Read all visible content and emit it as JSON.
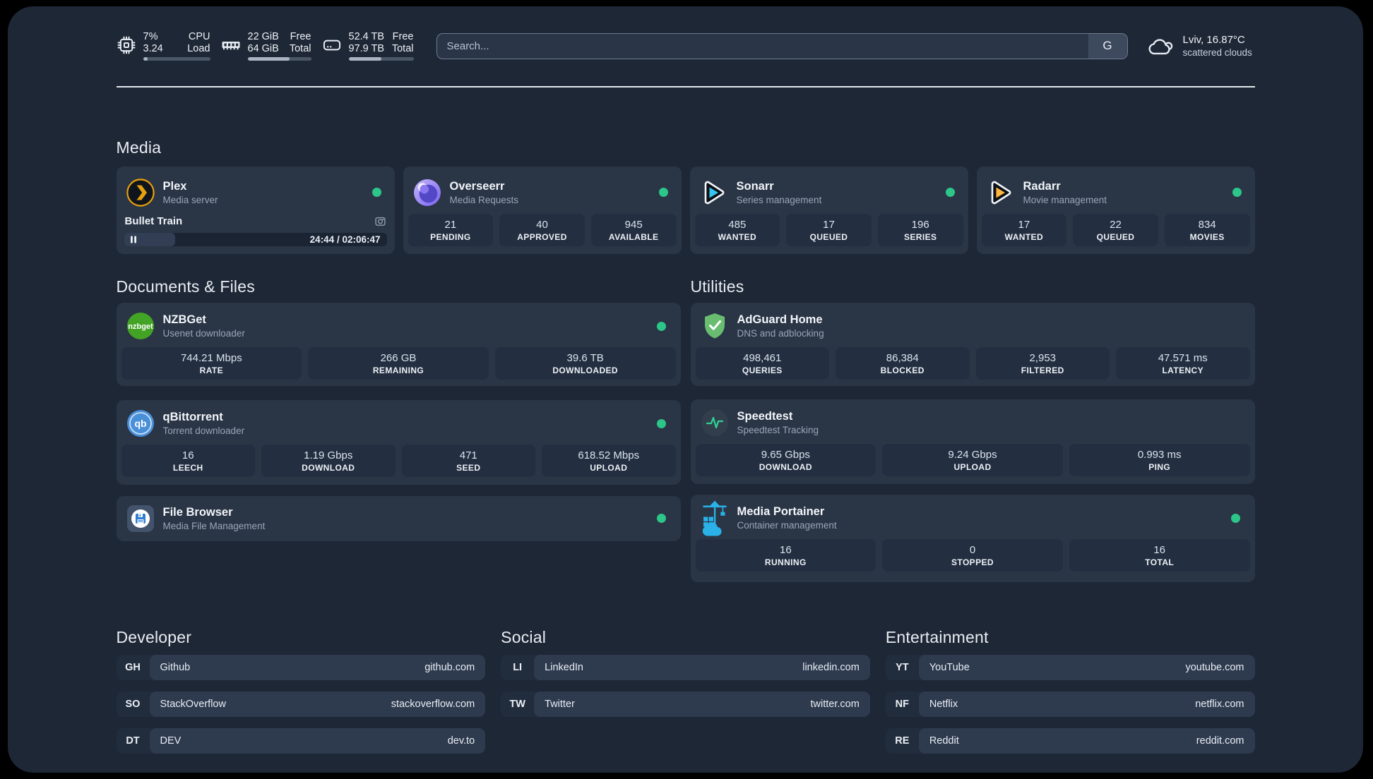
{
  "colors": {
    "status_online": "#2cc689",
    "plex_orange": "#e5a00d",
    "sonarr_blue": "#35c5f1",
    "radarr_yellow": "#f5a623",
    "nzbget_green": "#43a325",
    "adguard_green": "#68bd71",
    "qbittorrent_blue": "#4a90d9",
    "speedtest_green": "#2fd493",
    "portainer_blue": "#29b1e8",
    "filebrowser_blue": "#2e7dd1"
  },
  "topbar": {
    "cpu": {
      "value_top": "7%",
      "value_bottom": "3.24",
      "label_top": "CPU",
      "label_bottom": "Load",
      "progress": 7
    },
    "memory": {
      "value_top": "22 GiB",
      "value_bottom": "64 GiB",
      "label_top": "Free",
      "label_bottom": "Total",
      "progress": 66
    },
    "storage": {
      "value_top": "52.4 TB",
      "value_bottom": "97.9 TB",
      "label_top": "Free",
      "label_bottom": "Total",
      "progress": 50
    },
    "search": {
      "placeholder": "Search...",
      "button": "G"
    },
    "weather": {
      "location_temp": "Lviv, 16.87°C",
      "condition": "scattered clouds"
    }
  },
  "sections": {
    "media": "Media",
    "documents": "Documents & Files",
    "utilities": "Utilities",
    "developer": "Developer",
    "social": "Social",
    "entertainment": "Entertainment"
  },
  "apps": {
    "plex": {
      "name": "Plex",
      "desc": "Media server",
      "status_dot": true,
      "media": {
        "title": "Bullet Train",
        "time": "24:44 / 02:06:47",
        "progress": 19.5
      }
    },
    "overseerr": {
      "name": "Overseerr",
      "desc": "Media Requests",
      "status_dot": true,
      "stats": [
        {
          "value": "21",
          "label": "PENDING"
        },
        {
          "value": "40",
          "label": "APPROVED"
        },
        {
          "value": "945",
          "label": "AVAILABLE"
        }
      ]
    },
    "sonarr": {
      "name": "Sonarr",
      "desc": "Series management",
      "status_dot": true,
      "stats": [
        {
          "value": "485",
          "label": "WANTED"
        },
        {
          "value": "17",
          "label": "QUEUED"
        },
        {
          "value": "196",
          "label": "SERIES"
        }
      ]
    },
    "radarr": {
      "name": "Radarr",
      "desc": "Movie management",
      "status_dot": true,
      "stats": [
        {
          "value": "17",
          "label": "WANTED"
        },
        {
          "value": "22",
          "label": "QUEUED"
        },
        {
          "value": "834",
          "label": "MOVIES"
        }
      ]
    },
    "nzbget": {
      "name": "NZBGet",
      "desc": "Usenet downloader",
      "status_dot": true,
      "stats": [
        {
          "value": "744.21 Mbps",
          "label": "RATE"
        },
        {
          "value": "266 GB",
          "label": "REMAINING"
        },
        {
          "value": "39.6 TB",
          "label": "DOWNLOADED"
        }
      ]
    },
    "qbittorrent": {
      "name": "qBittorrent",
      "desc": "Torrent downloader",
      "status_dot": true,
      "stats": [
        {
          "value": "16",
          "label": "LEECH"
        },
        {
          "value": "1.19 Gbps",
          "label": "DOWNLOAD"
        },
        {
          "value": "471",
          "label": "SEED"
        },
        {
          "value": "618.52 Mbps",
          "label": "UPLOAD"
        }
      ]
    },
    "filebrowser": {
      "name": "File Browser",
      "desc": "Media File Management",
      "status_dot": true
    },
    "adguard": {
      "name": "AdGuard Home",
      "desc": "DNS and adblocking",
      "status_dot": false,
      "stats": [
        {
          "value": "498,461",
          "label": "QUERIES"
        },
        {
          "value": "86,384",
          "label": "BLOCKED"
        },
        {
          "value": "2,953",
          "label": "FILTERED"
        },
        {
          "value": "47.571 ms",
          "label": "LATENCY"
        }
      ]
    },
    "speedtest": {
      "name": "Speedtest",
      "desc": "Speedtest Tracking",
      "status_dot": false,
      "stats": [
        {
          "value": "9.65 Gbps",
          "label": "DOWNLOAD"
        },
        {
          "value": "9.24 Gbps",
          "label": "UPLOAD"
        },
        {
          "value": "0.993 ms",
          "label": "PING"
        }
      ]
    },
    "portainer": {
      "name": "Media Portainer",
      "desc": "Container management",
      "status_dot": true,
      "stats": [
        {
          "value": "16",
          "label": "RUNNING"
        },
        {
          "value": "0",
          "label": "STOPPED"
        },
        {
          "value": "16",
          "label": "TOTAL"
        }
      ]
    }
  },
  "links": {
    "developer": [
      {
        "abbr": "GH",
        "name": "Github",
        "url": "github.com"
      },
      {
        "abbr": "SO",
        "name": "StackOverflow",
        "url": "stackoverflow.com"
      },
      {
        "abbr": "DT",
        "name": "DEV",
        "url": "dev.to"
      }
    ],
    "social": [
      {
        "abbr": "LI",
        "name": "LinkedIn",
        "url": "linkedin.com"
      },
      {
        "abbr": "TW",
        "name": "Twitter",
        "url": "twitter.com"
      }
    ],
    "entertainment": [
      {
        "abbr": "YT",
        "name": "YouTube",
        "url": "youtube.com"
      },
      {
        "abbr": "NF",
        "name": "Netflix",
        "url": "netflix.com"
      },
      {
        "abbr": "RE",
        "name": "Reddit",
        "url": "reddit.com"
      }
    ]
  }
}
